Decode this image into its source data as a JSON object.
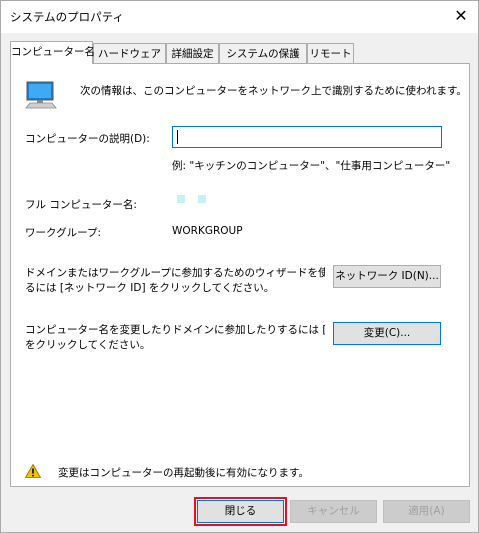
{
  "window": {
    "title": "システムのプロパティ",
    "close_symbol": "✕"
  },
  "tabs": [
    {
      "label": "コンピューター名",
      "active": true
    },
    {
      "label": "ハードウェア",
      "active": false
    },
    {
      "label": "詳細設定",
      "active": false
    },
    {
      "label": "システムの保護",
      "active": false
    },
    {
      "label": "リモート",
      "active": false
    }
  ],
  "panel": {
    "intro_text": "次の情報は、このコンピューターをネットワーク上で識別するために使われます。",
    "description_label": "コンピューターの説明(D):",
    "description_value": "",
    "description_example": "例: \"キッチンのコンピューター\"、\"仕事用コンピューター\"",
    "full_name_label": "フル コンピューター名:",
    "workgroup_label": "ワークグループ:",
    "workgroup_value": "WORKGROUP",
    "network_id_text_line1": "ドメインまたはワークグループに参加するためのウィザードを使用す",
    "network_id_text_line2": "るには [ネットワーク ID] をクリックしてください。",
    "network_id_button": "ネットワーク ID(N)...",
    "change_text_line1": "コンピューター名を変更したりドメインに参加したりするには [変更]",
    "change_text_line2": "をクリックしてください。",
    "change_button": "変更(C)...",
    "warning_text": "変更はコンピューターの再起動後に有効になります。",
    "icons": [
      "computer-icon",
      "warning-icon"
    ]
  },
  "footer": {
    "close_button": "閉じる",
    "cancel_button": "キャンセル",
    "apply_button": "適用(A)"
  },
  "colors": {
    "accent": "#0078d7",
    "highlight_border": "#e81123",
    "obscured_block": "#c8f0f8"
  }
}
